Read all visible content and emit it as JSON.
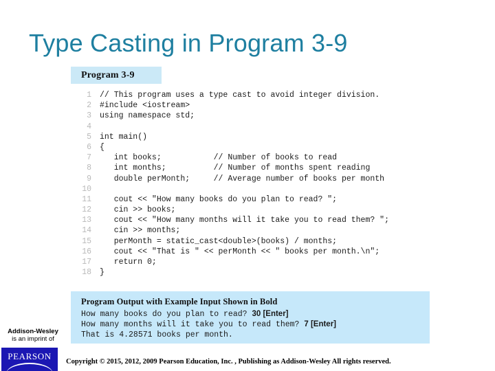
{
  "slide": {
    "title": "Type Casting in Program 3-9",
    "title_color": "#1e7fa0"
  },
  "program_figure": {
    "header_label": "Program 3-9",
    "header_bg": "#cbe9f7",
    "code_lines": [
      {
        "no": "1",
        "code": "// This program uses a type cast to avoid integer division."
      },
      {
        "no": "2",
        "code": "#include <iostream>"
      },
      {
        "no": "3",
        "code": "using namespace std;"
      },
      {
        "no": "4",
        "code": ""
      },
      {
        "no": "5",
        "code": "int main()"
      },
      {
        "no": "6",
        "code": "{"
      },
      {
        "no": "7",
        "code": "   int books;           // Number of books to read"
      },
      {
        "no": "8",
        "code": "   int months;          // Number of months spent reading"
      },
      {
        "no": "9",
        "code": "   double perMonth;     // Average number of books per month"
      },
      {
        "no": "10",
        "code": ""
      },
      {
        "no": "11",
        "code": "   cout << \"How many books do you plan to read? \";"
      },
      {
        "no": "12",
        "code": "   cin >> books;"
      },
      {
        "no": "13",
        "code": "   cout << \"How many months will it take you to read them? \";"
      },
      {
        "no": "14",
        "code": "   cin >> months;"
      },
      {
        "no": "15",
        "code": "   perMonth = static_cast<double>(books) / months;"
      },
      {
        "no": "16",
        "code": "   cout << \"That is \" << perMonth << \" books per month.\\n\";"
      },
      {
        "no": "17",
        "code": "   return 0;"
      },
      {
        "no": "18",
        "code": "}"
      }
    ]
  },
  "output_box": {
    "bg": "#c6e8fa",
    "title": "Program Output with Example Input Shown in Bold",
    "lines": [
      {
        "plain": "How many books do you plan to read? ",
        "bold": "30 [Enter]",
        "tail": ""
      },
      {
        "plain": "How many months will it take you to read them? ",
        "bold": "7 [Enter]",
        "tail": ""
      },
      {
        "plain": "That is 4.28571 books per month.",
        "bold": "",
        "tail": ""
      }
    ]
  },
  "footer": {
    "imprint_line1": "Addison-Wesley",
    "imprint_line2": "is an imprint of",
    "publisher_logo_text": "PEARSON",
    "publisher_logo_bg": "#1b17b3",
    "copyright": "Copyright © 2015, 2012, 2009 Pearson Education, Inc. , Publishing as Addison-Wesley All rights reserved."
  }
}
